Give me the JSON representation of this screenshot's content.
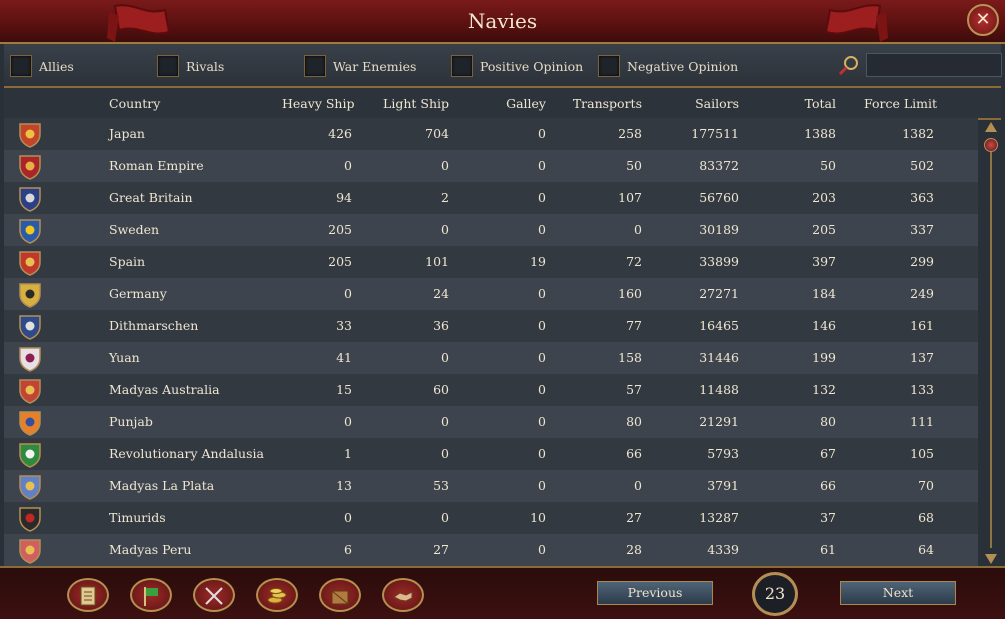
{
  "window": {
    "title": "Navies",
    "close_label": "✕"
  },
  "filters": [
    {
      "label": "Allies",
      "checked": false
    },
    {
      "label": "Rivals",
      "checked": false
    },
    {
      "label": "War Enemies",
      "checked": false
    },
    {
      "label": "Positive Opinion",
      "checked": false
    },
    {
      "label": "Negative Opinion",
      "checked": false
    }
  ],
  "search": {
    "value": "",
    "placeholder": ""
  },
  "columns": [
    "Country",
    "Heavy Ship",
    "Light Ship",
    "Galley",
    "Transports",
    "Sailors",
    "Total",
    "Force Limit"
  ],
  "rows": [
    {
      "country": "Japan",
      "heavy": "426",
      "light": "704",
      "galley": "0",
      "transports": "258",
      "sailors": "177511",
      "total": "1388",
      "force_limit": "1382",
      "flag_color": "#c2442a",
      "flag_accent": "#f0c040"
    },
    {
      "country": "Roman Empire",
      "heavy": "0",
      "light": "0",
      "galley": "0",
      "transports": "50",
      "sailors": "83372",
      "total": "50",
      "force_limit": "502",
      "flag_color": "#a8262a",
      "flag_accent": "#e8b040"
    },
    {
      "country": "Great Britain",
      "heavy": "94",
      "light": "2",
      "galley": "0",
      "transports": "107",
      "sailors": "56760",
      "total": "203",
      "force_limit": "363",
      "flag_color": "#2a3f86",
      "flag_accent": "#d8d8d8"
    },
    {
      "country": "Sweden",
      "heavy": "205",
      "light": "0",
      "galley": "0",
      "transports": "0",
      "sailors": "30189",
      "total": "205",
      "force_limit": "337",
      "flag_color": "#2b5aa8",
      "flag_accent": "#f0c820"
    },
    {
      "country": "Spain",
      "heavy": "205",
      "light": "101",
      "galley": "19",
      "transports": "72",
      "sailors": "33899",
      "total": "397",
      "force_limit": "299",
      "flag_color": "#c0382c",
      "flag_accent": "#e8c050"
    },
    {
      "country": "Germany",
      "heavy": "0",
      "light": "24",
      "galley": "0",
      "transports": "160",
      "sailors": "27271",
      "total": "184",
      "force_limit": "249",
      "flag_color": "#d8b040",
      "flag_accent": "#2a2a2a"
    },
    {
      "country": "Dithmarschen",
      "heavy": "33",
      "light": "36",
      "galley": "0",
      "transports": "77",
      "sailors": "16465",
      "total": "146",
      "force_limit": "161",
      "flag_color": "#2e4a8a",
      "flag_accent": "#e0e0e0"
    },
    {
      "country": "Yuan",
      "heavy": "41",
      "light": "0",
      "galley": "0",
      "transports": "158",
      "sailors": "31446",
      "total": "199",
      "force_limit": "137",
      "flag_color": "#e8e0e6",
      "flag_accent": "#8a2050"
    },
    {
      "country": "Madyas Australia",
      "heavy": "15",
      "light": "60",
      "galley": "0",
      "transports": "57",
      "sailors": "11488",
      "total": "132",
      "force_limit": "133",
      "flag_color": "#c24436",
      "flag_accent": "#e8c050"
    },
    {
      "country": "Punjab",
      "heavy": "0",
      "light": "0",
      "galley": "0",
      "transports": "80",
      "sailors": "21291",
      "total": "80",
      "force_limit": "111",
      "flag_color": "#e8802a",
      "flag_accent": "#3050a0"
    },
    {
      "country": "Revolutionary Andalusia",
      "heavy": "1",
      "light": "0",
      "galley": "0",
      "transports": "66",
      "sailors": "5793",
      "total": "67",
      "force_limit": "105",
      "flag_color": "#2e8a3e",
      "flag_accent": "#f2f2f2"
    },
    {
      "country": "Madyas La Plata",
      "heavy": "13",
      "light": "53",
      "galley": "0",
      "transports": "0",
      "sailors": "3791",
      "total": "66",
      "force_limit": "70",
      "flag_color": "#6080c8",
      "flag_accent": "#e8c050"
    },
    {
      "country": "Timurids",
      "heavy": "0",
      "light": "0",
      "galley": "10",
      "transports": "27",
      "sailors": "13287",
      "total": "37",
      "force_limit": "68",
      "flag_color": "#2a2a2a",
      "flag_accent": "#c02828"
    },
    {
      "country": "Madyas Peru",
      "heavy": "6",
      "light": "27",
      "galley": "0",
      "transports": "28",
      "sailors": "4339",
      "total": "61",
      "force_limit": "64",
      "flag_color": "#d06060",
      "flag_accent": "#e8c050"
    }
  ],
  "pagination": {
    "previous_label": "Previous",
    "next_label": "Next",
    "page": "23"
  },
  "toolbar": [
    "ledger-icon",
    "flag-icon",
    "crossed-swords-icon",
    "coins-icon",
    "trade-crate-icon",
    "handshake-icon"
  ],
  "colors": {
    "title_bar": "#6a1414",
    "gold_trim": "#a07b3e",
    "text": "#efe6d2",
    "row_a": "#323941",
    "row_b": "#3d444d"
  }
}
